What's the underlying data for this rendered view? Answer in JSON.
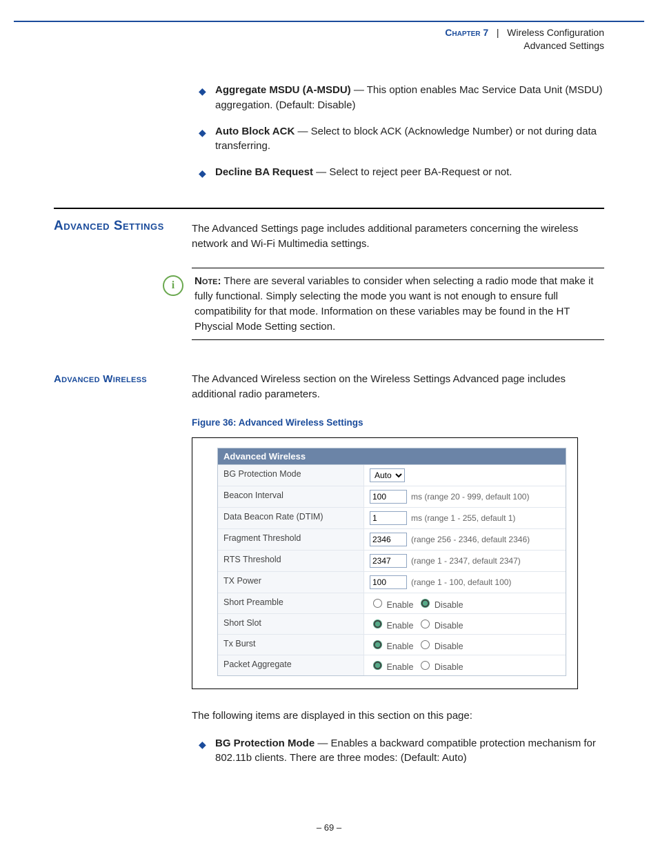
{
  "header": {
    "chapter": "Chapter 7",
    "sep": "|",
    "title": "Wireless Configuration",
    "subtitle": "Advanced Settings"
  },
  "bullets_top": [
    {
      "term": "Aggregate MSDU (A-MSDU)",
      "rest": " — This option enables Mac Service Data Unit (MSDU) aggregation. (Default: Disable)"
    },
    {
      "term": "Auto Block ACK",
      "rest": " — Select to block ACK (Acknowledge Number) or not during data transferring."
    },
    {
      "term": "Decline BA Request",
      "rest": " — Select to reject peer BA-Request or not."
    }
  ],
  "section_heading": "Advanced Settings",
  "intro": "The Advanced Settings page includes additional parameters concerning the wireless network and Wi-Fi Multimedia settings.",
  "note": {
    "label": "Note:",
    "text": " There are several variables to consider when selecting a radio mode that make it fully functional. Simply selecting the mode you want is not enough to ensure full compatibility for that mode. Information on these variables may be found in the HT Physcial Mode Setting section."
  },
  "subsection": {
    "heading": "Advanced Wireless",
    "text": "The Advanced Wireless section on the Wireless Settings Advanced page includes additional radio parameters."
  },
  "figure_caption": "Figure 36:  Advanced Wireless Settings",
  "aw": {
    "title": "Advanced Wireless",
    "rows": {
      "bg": {
        "label": "BG Protection Mode",
        "value": "Auto"
      },
      "beacon": {
        "label": "Beacon Interval",
        "value": "100",
        "hint": "ms (range 20 - 999, default 100)"
      },
      "dtim": {
        "label": "Data Beacon Rate (DTIM)",
        "value": "1",
        "hint": "ms (range 1 - 255, default 1)"
      },
      "frag": {
        "label": "Fragment Threshold",
        "value": "2346",
        "hint": "(range 256 - 2346, default 2346)"
      },
      "rts": {
        "label": "RTS Threshold",
        "value": "2347",
        "hint": "(range 1 - 2347, default 2347)"
      },
      "txp": {
        "label": "TX Power",
        "value": "100",
        "hint": "(range 1 - 100, default 100)"
      },
      "sp": {
        "label": "Short Preamble",
        "enable": "Enable",
        "disable": "Disable",
        "selected": "disable"
      },
      "ss": {
        "label": "Short Slot",
        "enable": "Enable",
        "disable": "Disable",
        "selected": "enable"
      },
      "txb": {
        "label": "Tx Burst",
        "enable": "Enable",
        "disable": "Disable",
        "selected": "enable"
      },
      "pa": {
        "label": "Packet Aggregate",
        "enable": "Enable",
        "disable": "Disable",
        "selected": "enable"
      }
    }
  },
  "post_text": "The following items are displayed in this section on this page:",
  "bullets_bottom": [
    {
      "term": "BG Protection Mode",
      "rest": " — Enables a backward compatible protection mechanism for 802.11b clients. There are three modes: (Default: Auto)"
    }
  ],
  "page_number": "–  69  –"
}
